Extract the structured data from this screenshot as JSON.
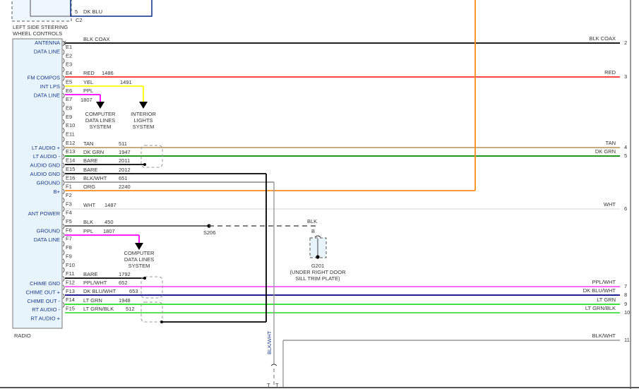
{
  "steering": {
    "pin": "5",
    "wire": "DK BLU",
    "connector": "C2",
    "label_line1": "LEFT SIDE STEERING",
    "label_line2": "WHEEL CONTROLS"
  },
  "radio": {
    "label": "RADIO",
    "functions": [
      {
        "text": "ANTENNA",
        "row": 0
      },
      {
        "text": "DATA LINE",
        "row": 1
      },
      {
        "text": "FM COMPOS",
        "row": 4
      },
      {
        "text": "INT LPS",
        "row": 5
      },
      {
        "text": "DATA LINE",
        "row": 6
      },
      {
        "text": "LT AUDIO +",
        "row": 12
      },
      {
        "text": "LT AUDIO -",
        "row": 13
      },
      {
        "text": "AUDIO GND",
        "row": 14
      },
      {
        "text": "AUDIO GND",
        "row": 15
      },
      {
        "text": "GROUND",
        "row": 16
      },
      {
        "text": "B+",
        "row": 17
      },
      {
        "text": "ANT POWER",
        "row": 19.5
      },
      {
        "text": "GROUND",
        "row": 21.5
      },
      {
        "text": "DATA LINE",
        "row": 22.5
      },
      {
        "text": "CHIME GND",
        "row": 27.5
      },
      {
        "text": "CHIME OUT +",
        "row": 28.5
      },
      {
        "text": "CHIME OUT -",
        "row": 29.5
      },
      {
        "text": "RT AUDIO -",
        "row": 30.5
      },
      {
        "text": "RT AUDIO +",
        "row": 31.5
      }
    ],
    "pins": [
      "E1",
      "E2",
      "E3",
      "E4",
      "E5",
      "E6",
      "E7",
      "E8",
      "E9",
      "E10",
      "E11",
      "E12",
      "E13",
      "E14",
      "E15",
      "E16",
      "F1",
      "F2",
      "F3",
      "F4",
      "F5",
      "F6",
      "F7",
      "F8",
      "F9",
      "F10",
      "F11",
      "F12",
      "F13",
      "F14",
      "F15"
    ]
  },
  "wires": [
    {
      "id": "antenna",
      "color_name": "BLK COAX",
      "circuit": "",
      "stroke": "#000000",
      "end_label": "BLK COAX",
      "end_pin": "2"
    },
    {
      "id": "fm",
      "color_name": "RED",
      "circuit": "1486",
      "stroke": "#ff2a2a",
      "end_label": "RED",
      "end_pin": "3"
    },
    {
      "id": "intlps",
      "color_name": "YEL",
      "circuit": "1491",
      "stroke": "#ffff00"
    },
    {
      "id": "data1",
      "color_name": "PPL",
      "circuit": "1807",
      "stroke": "#ff00ff"
    },
    {
      "id": "lta+",
      "color_name": "TAN",
      "circuit": "511",
      "stroke": "#bfa070",
      "end_label": "TAN",
      "end_pin": "4"
    },
    {
      "id": "lta-",
      "color_name": "DK GRN",
      "circuit": "1947",
      "stroke": "#008800",
      "end_label": "DK GRN",
      "end_pin": "5"
    },
    {
      "id": "agnd1",
      "color_name": "BARE",
      "circuit": "2011",
      "stroke": "#000000"
    },
    {
      "id": "agnd2",
      "color_name": "BARE",
      "circuit": "2012",
      "stroke": "#000000"
    },
    {
      "id": "gnd",
      "color_name": "BLK/WHT",
      "circuit": "651",
      "stroke": "#999999"
    },
    {
      "id": "bplus",
      "color_name": "ORG",
      "circuit": "2240",
      "stroke": "#ff8c1a"
    },
    {
      "id": "antpwr",
      "color_name": "WHT",
      "circuit": "1487",
      "stroke": "#dddddd",
      "end_label": "WHT",
      "end_pin": "6"
    },
    {
      "id": "gnd2",
      "color_name": "BLK",
      "circuit": "450",
      "stroke": "#555555"
    },
    {
      "id": "data2",
      "color_name": "PPL",
      "circuit": "1807",
      "stroke": "#ff00ff"
    },
    {
      "id": "chgnd",
      "color_name": "BARE",
      "circuit": "1792",
      "stroke": "#000000"
    },
    {
      "id": "ch+",
      "color_name": "PPL/WHT",
      "circuit": "652",
      "stroke": "#ff55ff",
      "end_label": "PPL/WHT",
      "end_pin": "7"
    },
    {
      "id": "ch-",
      "color_name": "DK BLU/WHT",
      "circuit": "653",
      "stroke": "#000080",
      "end_label": "DK BLU/WHT",
      "end_pin": "8"
    },
    {
      "id": "rta-",
      "color_name": "LT GRN",
      "circuit": "1948",
      "stroke": "#22dd22",
      "end_label": "LT GRN",
      "end_pin": "9"
    },
    {
      "id": "rta+",
      "color_name": "LT GRN/BLK",
      "circuit": "512",
      "stroke": "#44dd44",
      "end_label": "LT GRN/BLK",
      "end_pin": "10"
    }
  ],
  "destinations": {
    "computer_data_lines": [
      "COMPUTER",
      "DATA LINES",
      "SYSTEM"
    ],
    "interior_lights": [
      "INTERIOR",
      "LIGHTS",
      "SYSTEM"
    ]
  },
  "splice": {
    "label": "S206"
  },
  "ground": {
    "wire": "BLK",
    "pin": "B",
    "label": "G201",
    "location_line1": "(UNDER RIGHT DOOR",
    "location_line2": "SILL TRIM PLATE)"
  },
  "blkwht_lower": {
    "vertical_label": "BLK/WHT",
    "end_label": "BLK/WHT",
    "end_pin": "11"
  },
  "bottom_pin": "T"
}
